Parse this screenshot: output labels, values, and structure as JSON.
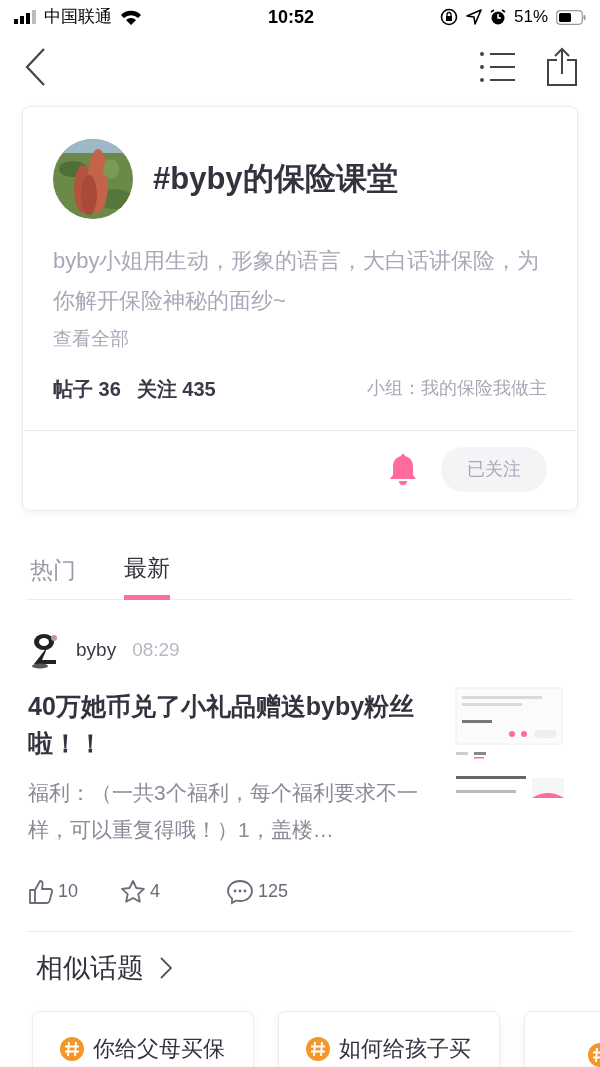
{
  "status_bar": {
    "carrier": "中国联通",
    "time": "10:52",
    "battery": "51%"
  },
  "topic": {
    "title": "#byby的保险课堂",
    "description": "byby小姐用生动，形象的语言，大白话讲保险，为你解开保险神秘的面纱~",
    "more": "查看全部",
    "stats": [
      {
        "label": "帖子",
        "value": "36"
      },
      {
        "label": "关注",
        "value": "435"
      }
    ],
    "group": "小组：我的保险我做主",
    "follow_button": "已关注",
    "followed": true
  },
  "tabs": [
    {
      "label": "热门",
      "selected": false
    },
    {
      "label": "最新",
      "selected": true
    }
  ],
  "posts": [
    {
      "author": "byby",
      "time": "08:29",
      "title": "40万她币兑了小礼品赠送byby粉丝啦！！",
      "excerpt": "福利：（一共3个福利，每个福利要求不一样，可以重复得哦！）1，盖楼…",
      "likes": "10",
      "favorites": "4",
      "comments": "125"
    }
  ],
  "related": {
    "title": "相似话题",
    "topics": [
      {
        "kind": "card",
        "title": "你给父母买保"
      },
      {
        "kind": "card",
        "title": "如何给孩子买"
      },
      {
        "kind": "edge"
      }
    ]
  }
}
